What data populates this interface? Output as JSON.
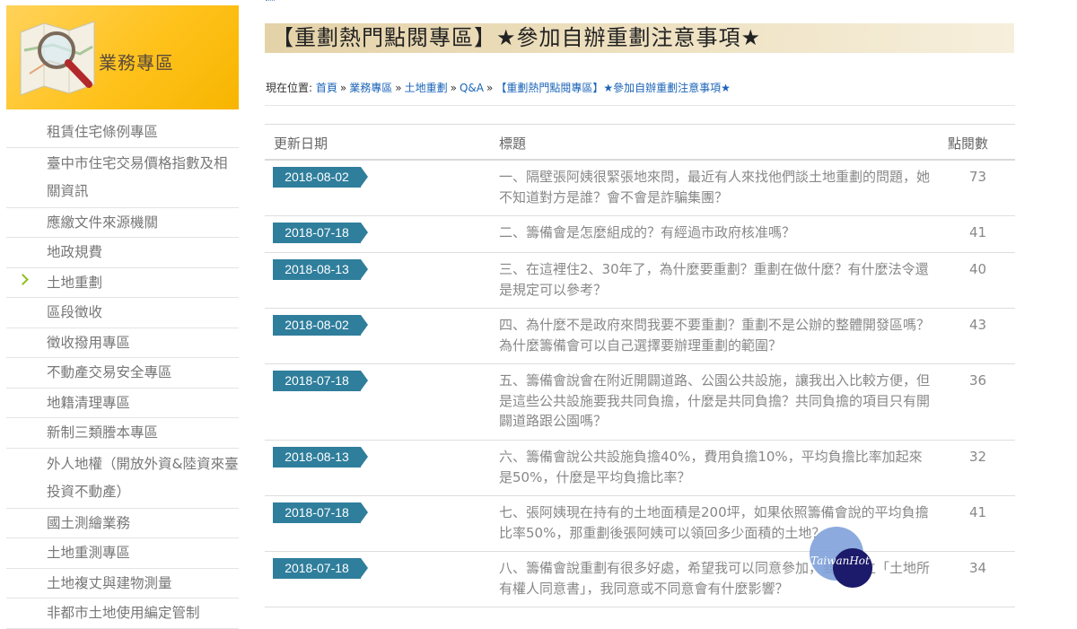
{
  "sidebar": {
    "banner_title": "業務專區",
    "items": [
      {
        "label": "租賃住宅條例專區",
        "lines": 1
      },
      {
        "label": "臺中市住宅交易價格指數及相關資訊",
        "lines": 2
      },
      {
        "label": "應繳文件來源機關",
        "lines": 1
      },
      {
        "label": "地政規費",
        "lines": 1
      },
      {
        "label": "土地重劃",
        "lines": 1,
        "active": true
      },
      {
        "label": "區段徵收",
        "lines": 1
      },
      {
        "label": "徵收撥用專區",
        "lines": 1
      },
      {
        "label": "不動產交易安全專區",
        "lines": 1
      },
      {
        "label": "地籍清理專區",
        "lines": 1
      },
      {
        "label": "新制三類謄本專區",
        "lines": 1
      },
      {
        "label": "外人地權（開放外資&陸資來臺投資不動產）",
        "lines": 2
      },
      {
        "label": "國土測繪業務",
        "lines": 1
      },
      {
        "label": "土地重測專區",
        "lines": 1
      },
      {
        "label": "土地複丈與建物測量",
        "lines": 1
      },
      {
        "label": "非都市土地使用編定管制",
        "lines": 1
      }
    ]
  },
  "main": {
    "page_title": "【重劃熱門點閱專區】★參加自辦重劃注意事項★",
    "breadcrumb": {
      "prefix": "現在位置:",
      "items": [
        "首頁",
        "業務專區",
        "土地重劃",
        "Q&A",
        "【重劃熱門點閱專區】★參加自辦重劃注意事項★"
      ],
      "separator": "»"
    },
    "table": {
      "headers": {
        "date": "更新日期",
        "title": "標題",
        "views": "點閱數"
      },
      "rows": [
        {
          "date": "2018-08-02",
          "title": "一、隔壁張阿姨很緊張地來問，最近有人來找他們談土地重劃的問題，她不知道對方是誰？會不會是詐騙集團？",
          "views": "73",
          "lines": 2
        },
        {
          "date": "2018-07-18",
          "title": "二、籌備會是怎麼組成的？有經過市政府核准嗎？",
          "views": "41",
          "lines": 1
        },
        {
          "date": "2018-08-13",
          "title": "三、在這裡住2、30年了，為什麼要重劃？重劃在做什麼？有什麼法令還是規定可以參考？",
          "views": "40",
          "lines": 2
        },
        {
          "date": "2018-08-02",
          "title": "四、為什麼不是政府來問我要不要重劃？重劃不是公辦的整體開發區嗎？為什麼籌備會可以自己選擇要辦理重劃的範圍？",
          "views": "43",
          "lines": 2
        },
        {
          "date": "2018-07-18",
          "title": "五、籌備會說會在附近開闢道路、公園公共設施，讓我出入比較方便，但是這些公共設施要我共同負擔，什麼是共同負擔？共同負擔的項目只有開闢道路跟公園嗎？",
          "views": "36",
          "lines": 3
        },
        {
          "date": "2018-08-13",
          "title": "六、籌備會說公共設施負擔40%，費用負擔10%，平均負擔比率加起來是50%，什麼是平均負擔比率？",
          "views": "32",
          "lines": 2
        },
        {
          "date": "2018-07-18",
          "title": "七、張阿姨現在持有的土地面積是200坪，如果依照籌備會說的平均負擔比率50%，那重劃後張阿姨可以領回多少面積的土地？",
          "views": "41",
          "lines": 2
        },
        {
          "date": "2018-07-18",
          "title": "八、籌備會說重劃有很多好處，希望我可以同意參加，要我簽立「土地所有權人同意書」，我同意或不同意會有什麼影響？",
          "views": "34",
          "lines": 2
        }
      ]
    }
  },
  "watermark": {
    "text": "TaiwanHot"
  },
  "colors": {
    "date_badge": "#2f7e9c",
    "banner": "#ffc21c",
    "link": "#1b64b8",
    "active_chevron": "#8cbf1e"
  }
}
